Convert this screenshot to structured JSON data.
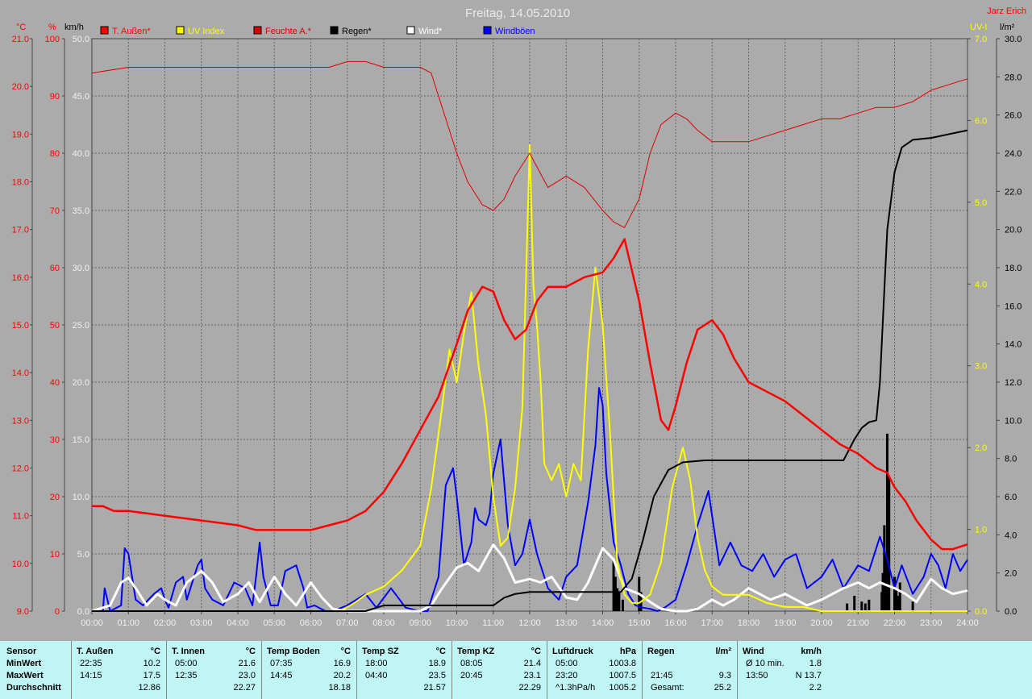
{
  "title": "Freitag, 14.05.2010",
  "author": "Jarz Erich",
  "colors": {
    "temp": "#ff0000",
    "humidity": "#dd0000",
    "uv": "#ffff00",
    "rain": "#000000",
    "wind": "#ffffff",
    "gust": "#0000ff",
    "background": "#ababab",
    "stats_bg": "#bff5f5"
  },
  "axis_units": {
    "temp": "°C",
    "humidity": "%",
    "wind": "km/h",
    "uv": "UV-I",
    "rain": "l/m²"
  },
  "legend": [
    {
      "label": "T. Außen*",
      "color": "#ff0000"
    },
    {
      "label": "UV Index",
      "color": "#ffff00"
    },
    {
      "label": "Feuchte A.*",
      "color": "#dd0000"
    },
    {
      "label": "Regen*",
      "color": "#000000"
    },
    {
      "label": "Wind*",
      "color": "#ffffff"
    },
    {
      "label": "Windböen",
      "color": "#0000ff"
    }
  ],
  "chart_data": {
    "type": "line",
    "title": "Freitag, 14.05.2010",
    "grid": true,
    "legend_placement": "top",
    "x_ticks": [
      "00:00",
      "01:00",
      "02:00",
      "03:00",
      "04:00",
      "05:00",
      "06:00",
      "07:00",
      "08:00",
      "09:00",
      "10:00",
      "11:00",
      "12:00",
      "13:00",
      "14:00",
      "15:00",
      "16:00",
      "17:00",
      "18:00",
      "19:00",
      "20:00",
      "21:00",
      "22:00",
      "23:00",
      "24:00"
    ],
    "axes": {
      "temp": {
        "unit": "°C",
        "range": [
          9.0,
          21.0
        ],
        "ticks": [
          "21.0",
          "20.0",
          "19.0",
          "18.0",
          "17.0",
          "16.0",
          "15.0",
          "14.0",
          "13.0",
          "12.0",
          "11.0",
          "10.0",
          "9.0"
        ]
      },
      "humidity": {
        "unit": "%",
        "range": [
          0,
          100
        ],
        "ticks": [
          "100",
          "90",
          "80",
          "70",
          "60",
          "50",
          "40",
          "30",
          "20",
          "10",
          "0"
        ]
      },
      "wind": {
        "unit": "km/h",
        "range": [
          0,
          50
        ],
        "ticks": [
          "50.0",
          "45.0",
          "40.0",
          "35.0",
          "30.0",
          "25.0",
          "20.0",
          "15.0",
          "10.0",
          "5.0",
          "0.0"
        ]
      },
      "uv": {
        "unit": "UV-I",
        "range": [
          0,
          7
        ],
        "ticks": [
          "7.0",
          "6.0",
          "5.0",
          "4.0",
          "3.0",
          "2.0",
          "1.0",
          "0.0"
        ]
      },
      "rain": {
        "unit": "l/m²",
        "range": [
          0,
          30
        ],
        "ticks": [
          "30.0",
          "28.0",
          "26.0",
          "24.0",
          "22.0",
          "20.0",
          "18.0",
          "16.0",
          "14.0",
          "12.0",
          "10.0",
          "8.0",
          "6.0",
          "4.0",
          "2.0",
          "0.0"
        ]
      }
    },
    "series": [
      {
        "name": "T. Außen*",
        "axis": "temp",
        "x_hours": [
          0,
          0.3,
          0.6,
          1,
          2,
          3,
          4,
          4.5,
          5,
          6,
          6.5,
          7,
          7.5,
          8,
          8.5,
          9,
          9.5,
          10,
          10.3,
          10.7,
          11,
          11.3,
          11.6,
          11.9,
          12.2,
          12.5,
          13,
          13.5,
          14,
          14.3,
          14.6,
          15,
          15.3,
          15.6,
          15.8,
          16,
          16.3,
          16.6,
          17,
          17.3,
          17.6,
          18,
          18.5,
          19,
          19.5,
          20,
          20.5,
          21,
          21.5,
          21.8,
          22,
          22.3,
          22.6,
          23,
          23.3,
          23.6,
          24
        ],
        "values": [
          11.2,
          11.2,
          11.1,
          11.1,
          11.0,
          10.9,
          10.8,
          10.7,
          10.7,
          10.7,
          10.8,
          10.9,
          11.1,
          11.5,
          12.1,
          12.8,
          13.5,
          14.6,
          15.3,
          15.8,
          15.7,
          15.1,
          14.7,
          14.9,
          15.5,
          15.8,
          15.8,
          16.0,
          16.1,
          16.4,
          16.8,
          15.5,
          14.2,
          13.0,
          12.8,
          13.3,
          14.2,
          14.9,
          15.1,
          14.8,
          14.3,
          13.8,
          13.6,
          13.4,
          13.1,
          12.8,
          12.5,
          12.3,
          12.0,
          11.9,
          11.6,
          11.3,
          10.9,
          10.5,
          10.3,
          10.3,
          10.4
        ]
      },
      {
        "name": "Feuchte A.*",
        "axis": "humidity",
        "x_hours": [
          0,
          1,
          2,
          3,
          4,
          5,
          6,
          6.5,
          7,
          7.5,
          8,
          9,
          9.3,
          9.6,
          10,
          10.3,
          10.7,
          11,
          11.3,
          11.6,
          12,
          12.5,
          13,
          13.5,
          14,
          14.3,
          14.6,
          15,
          15.3,
          15.6,
          16,
          16.3,
          16.6,
          17,
          17.5,
          18,
          18.5,
          19,
          19.5,
          20,
          20.5,
          21,
          21.5,
          22,
          22.5,
          23,
          23.5,
          24
        ],
        "values": [
          94,
          95,
          95,
          95,
          95,
          95,
          95,
          95,
          96,
          96,
          95,
          95,
          94,
          88,
          80,
          75,
          71,
          70,
          72,
          76,
          80,
          74,
          76,
          74,
          70,
          68,
          67,
          72,
          80,
          85,
          87,
          86,
          84,
          82,
          82,
          82,
          83,
          84,
          85,
          86,
          86,
          87,
          88,
          88,
          89,
          91,
          92,
          93
        ]
      },
      {
        "name": "UV Index",
        "axis": "uv",
        "x_hours": [
          0,
          6.8,
          7.2,
          7.5,
          8,
          8.5,
          9,
          9.3,
          9.6,
          9.8,
          10,
          10.2,
          10.4,
          10.6,
          10.8,
          11,
          11.2,
          11.4,
          11.6,
          11.8,
          12,
          12.1,
          12.2,
          12.3,
          12.4,
          12.6,
          12.8,
          13,
          13.2,
          13.4,
          13.6,
          13.8,
          14,
          14.2,
          14.4,
          14.6,
          14.8,
          15,
          15.3,
          15.6,
          15.9,
          16.2,
          16.4,
          16.6,
          16.8,
          17,
          17.3,
          17.6,
          18,
          18.5,
          19,
          19.5,
          20,
          20.5,
          21,
          21.5,
          22,
          24
        ],
        "values": [
          0,
          0,
          0.1,
          0.2,
          0.3,
          0.5,
          0.8,
          1.5,
          2.5,
          3.2,
          2.8,
          3.4,
          3.9,
          3.0,
          2.4,
          1.4,
          0.8,
          0.9,
          1.5,
          2.5,
          5.7,
          4.0,
          3.5,
          2.8,
          1.8,
          1.6,
          1.8,
          1.4,
          1.8,
          1.6,
          3.2,
          4.2,
          3.5,
          2.2,
          0.6,
          0.2,
          0.1,
          0.1,
          0.2,
          0.6,
          1.5,
          2.0,
          1.6,
          0.9,
          0.5,
          0.3,
          0.2,
          0.2,
          0.2,
          0.1,
          0.05,
          0.05,
          0,
          0,
          0,
          0,
          0,
          0
        ]
      },
      {
        "name": "Regen*",
        "axis": "rain",
        "x_hours": [
          0,
          7.5,
          8,
          9,
          10,
          11,
          11.3,
          11.6,
          12,
          13,
          14,
          14.5,
          14.8,
          15.1,
          15.4,
          15.8,
          16.2,
          16.8,
          18,
          19,
          20,
          20.6,
          20.9,
          21.1,
          21.3,
          21.5,
          21.6,
          21.7,
          21.8,
          22.0,
          22.2,
          22.5,
          23,
          23.5,
          24
        ],
        "values": [
          0,
          0,
          0.3,
          0.3,
          0.3,
          0.3,
          0.7,
          0.9,
          1.0,
          1.0,
          1.0,
          1.0,
          1.7,
          3.7,
          6.0,
          7.4,
          7.8,
          7.9,
          7.9,
          7.9,
          7.9,
          7.9,
          9.0,
          9.6,
          9.9,
          10.0,
          12.0,
          16.0,
          20.0,
          23.0,
          24.3,
          24.7,
          24.8,
          25.0,
          25.2
        ]
      },
      {
        "name": "Wind*",
        "axis": "wind",
        "x_hours": [
          0,
          0.5,
          0.8,
          1.0,
          1.2,
          1.5,
          1.8,
          2.0,
          2.3,
          2.6,
          3.0,
          3.3,
          3.6,
          4.0,
          4.3,
          4.6,
          5.0,
          5.3,
          5.6,
          6.0,
          6.3,
          6.6,
          7.0,
          7.5,
          8,
          8.5,
          9,
          9.3,
          9.6,
          10,
          10.3,
          10.6,
          11,
          11.3,
          11.6,
          12,
          12.3,
          12.6,
          13,
          13.3,
          13.6,
          14,
          14.3,
          14.6,
          15,
          15.3,
          15.6,
          16,
          16.3,
          16.6,
          17,
          17.3,
          17.6,
          18,
          18.3,
          18.6,
          19,
          19.3,
          19.6,
          20,
          20.3,
          20.6,
          21,
          21.3,
          21.6,
          22,
          22.3,
          22.6,
          23,
          23.3,
          23.6,
          24
        ],
        "values": [
          0,
          0.5,
          2.5,
          2.9,
          2.0,
          0.5,
          1.5,
          1.0,
          0.5,
          2.5,
          3.5,
          2.5,
          0.8,
          1.5,
          2.5,
          0.8,
          3.0,
          1.5,
          0.5,
          2.5,
          1.2,
          0.2,
          0,
          0,
          0,
          0,
          0,
          0.5,
          2,
          3.8,
          4.2,
          3.5,
          5.8,
          4.6,
          2.5,
          2.8,
          2.5,
          3,
          1.2,
          1.0,
          2.5,
          5.5,
          4.5,
          2.0,
          1.5,
          0.8,
          0.2,
          0,
          0,
          0.2,
          1.0,
          0.5,
          1.0,
          2.0,
          1.5,
          1.0,
          1.5,
          1.0,
          0.5,
          1.0,
          1.5,
          2.0,
          2.5,
          2.0,
          2.5,
          2.0,
          1.5,
          0.8,
          2.8,
          2.0,
          1.5,
          1.8
        ]
      },
      {
        "name": "Windböen",
        "axis": "wind",
        "x_hours": [
          0,
          0.3,
          0.35,
          0.5,
          0.8,
          0.9,
          1.0,
          1.2,
          1.4,
          1.7,
          1.9,
          2.0,
          2.1,
          2.3,
          2.5,
          2.6,
          2.9,
          3.0,
          3.1,
          3.3,
          3.6,
          3.9,
          4.2,
          4.4,
          4.5,
          4.6,
          4.7,
          4.9,
          5.1,
          5.3,
          5.6,
          5.8,
          5.9,
          6.1,
          6.4,
          6.6,
          7,
          7.5,
          7.8,
          8.2,
          8.6,
          9,
          9.2,
          9.5,
          9.7,
          9.9,
          10.0,
          10.2,
          10.4,
          10.5,
          10.6,
          10.8,
          10.9,
          11.0,
          11.2,
          11.4,
          11.6,
          11.8,
          12.0,
          12.2,
          12.5,
          12.8,
          13.0,
          13.3,
          13.6,
          13.8,
          13.9,
          14.0,
          14.1,
          14.3,
          14.5,
          14.7,
          14.9,
          15.1,
          15.3,
          15.5,
          15.7,
          16,
          16.3,
          16.6,
          16.9,
          17.2,
          17.5,
          17.8,
          18.1,
          18.4,
          18.7,
          19,
          19.3,
          19.6,
          20,
          20.3,
          20.6,
          21,
          21.3,
          21.6,
          21.8,
          22.0,
          22.2,
          22.5,
          22.8,
          23,
          23.2,
          23.4,
          23.6,
          23.8,
          24
        ],
        "values": [
          0,
          0,
          2,
          0,
          0.5,
          5.5,
          5.0,
          1.0,
          0.5,
          1.5,
          2.0,
          1.0,
          0.3,
          2.5,
          3.0,
          1.0,
          4.0,
          4.5,
          2.0,
          1.0,
          0.5,
          2.5,
          2.0,
          0.5,
          3.0,
          6.0,
          3.0,
          0.5,
          0.5,
          3.5,
          4.0,
          2.0,
          0.3,
          0.5,
          0,
          0,
          0.5,
          1.5,
          0.3,
          2.0,
          0.3,
          0,
          0,
          3.0,
          11.0,
          12.5,
          10.0,
          4.0,
          6.0,
          9.0,
          8.0,
          7.5,
          8.5,
          12.0,
          15.0,
          7.5,
          4.0,
          5.0,
          8.0,
          5.0,
          2.0,
          1.0,
          3.0,
          4.0,
          9.5,
          14.5,
          19.5,
          18.0,
          12.0,
          6.0,
          4.0,
          1.5,
          0.5,
          0.3,
          0.2,
          0,
          0.3,
          1.0,
          4.0,
          7.5,
          10.5,
          4.0,
          6.0,
          4.0,
          3.5,
          5.0,
          3.0,
          4.5,
          5.0,
          2.0,
          3.0,
          4.5,
          2.0,
          4.0,
          3.5,
          6.5,
          4.5,
          2.0,
          4.0,
          1.5,
          3.0,
          5.0,
          4.0,
          2.0,
          5.0,
          3.5,
          4.5,
          3.0
        ]
      }
    ],
    "rain_bars": {
      "axis": "rain",
      "x_hours": [
        14.3,
        14.35,
        14.4,
        14.45,
        14.55,
        15.0,
        15.05,
        20.7,
        20.9,
        21.1,
        21.2,
        21.3,
        21.65,
        21.68,
        21.72,
        21.75,
        21.8,
        21.85,
        22.0,
        22.05,
        22.1,
        22.15,
        22.5
      ],
      "values": [
        2.6,
        1.8,
        1.2,
        1.0,
        0.6,
        1.8,
        1.0,
        0.4,
        0.8,
        0.5,
        0.4,
        0.6,
        1.0,
        2.0,
        4.5,
        3.0,
        9.3,
        7.0,
        1.8,
        1.2,
        0.8,
        1.5,
        0.5
      ]
    }
  },
  "stats": {
    "row_labels": [
      "Sensor",
      "MinWert",
      "MaxWert",
      "Durchschnitt"
    ],
    "groups": [
      {
        "title": "T. Außen",
        "unit": "°C",
        "rows": [
          [
            "22:35",
            "10.2"
          ],
          [
            "14:15",
            "17.5"
          ],
          [
            "",
            "12.86"
          ]
        ]
      },
      {
        "title": "T. Innen",
        "unit": "°C",
        "rows": [
          [
            "05:00",
            "21.6"
          ],
          [
            "12:35",
            "23.0"
          ],
          [
            "",
            "22.27"
          ]
        ]
      },
      {
        "title": "Temp Boden",
        "unit": "°C",
        "rows": [
          [
            "07:35",
            "16.9"
          ],
          [
            "14:45",
            "20.2"
          ],
          [
            "",
            "18.18"
          ]
        ]
      },
      {
        "title": "Temp SZ",
        "unit": "°C",
        "rows": [
          [
            "18:00",
            "18.9"
          ],
          [
            "04:40",
            "23.5"
          ],
          [
            "",
            "21.57"
          ]
        ]
      },
      {
        "title": "Temp KZ",
        "unit": "°C",
        "rows": [
          [
            "08:05",
            "21.4"
          ],
          [
            "20:45",
            "23.1"
          ],
          [
            "",
            "22.29"
          ]
        ]
      },
      {
        "title": "Luftdruck",
        "unit": "hPa",
        "rows": [
          [
            "05:00",
            "1003.8"
          ],
          [
            "23:20",
            "1007.5"
          ],
          [
            "^1.3hPa/h",
            "1005.2"
          ]
        ]
      },
      {
        "title": "Regen",
        "unit": "l/m²",
        "rows": [
          [
            "",
            ""
          ],
          [
            "21:45",
            "9.3"
          ],
          [
            "Gesamt:",
            "25.2"
          ]
        ]
      },
      {
        "title": "Wind",
        "unit": "km/h",
        "rows": [
          [
            "Ø 10 min.",
            "1.8"
          ],
          [
            "13:50",
            "N 13.7"
          ],
          [
            "",
            "2.2"
          ]
        ]
      }
    ]
  }
}
